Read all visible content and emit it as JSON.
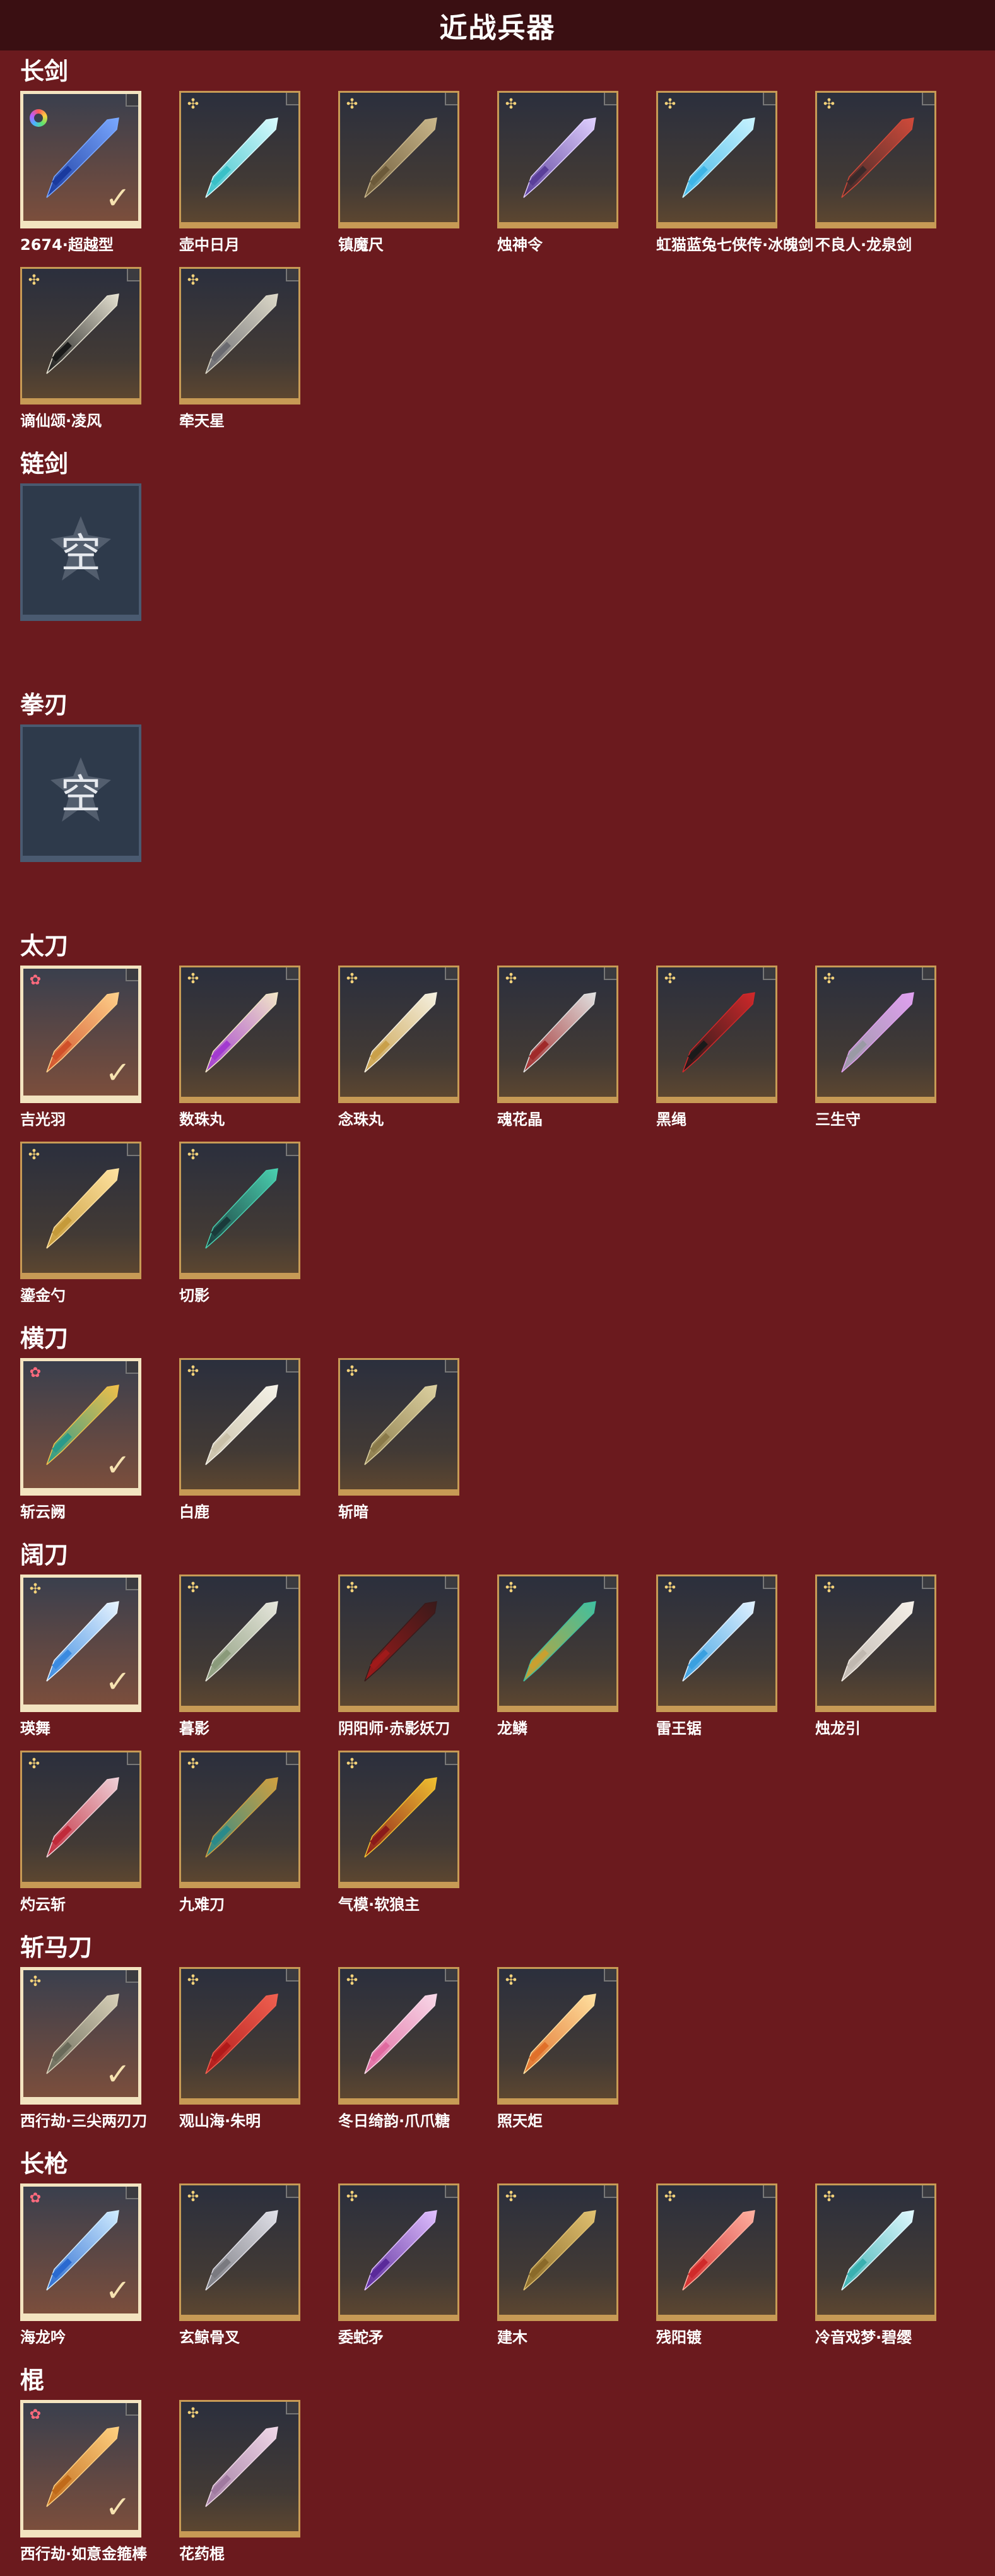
{
  "page_title": "近战兵器",
  "empty_label": "空",
  "sections": [
    {
      "title": "长剑",
      "items": [
        {
          "label": "2674·超越型",
          "badge": "ring",
          "selected": true,
          "colors": [
            "#1a3a9e",
            "#7aa8ff"
          ]
        },
        {
          "label": "壶中日月",
          "badge": "star",
          "colors": [
            "#3ac0c7",
            "#d9fbff"
          ]
        },
        {
          "label": "镇魔尺",
          "badge": "star",
          "colors": [
            "#6c5a3a",
            "#c9b68a"
          ]
        },
        {
          "label": "烛神令",
          "badge": "star",
          "colors": [
            "#5a3f9a",
            "#e0d0ff"
          ]
        },
        {
          "label": "虹猫蓝兔七侠传·冰魄剑",
          "badge": "star",
          "colors": [
            "#3fb5e6",
            "#c8f3ff"
          ]
        },
        {
          "label": "不良人·龙泉剑",
          "badge": "star",
          "colors": [
            "#3a2a2a",
            "#d04a3a"
          ]
        },
        {
          "label": "谪仙颂·凌风",
          "badge": "star",
          "colors": [
            "#1a1a1a",
            "#e6e2d2"
          ]
        },
        {
          "label": "牵天星",
          "badge": "star",
          "colors": [
            "#6a6a70",
            "#dcd8c8"
          ]
        }
      ]
    },
    {
      "title": "链剑",
      "items": []
    },
    {
      "title": "拳刃",
      "items": []
    },
    {
      "title": "太刀",
      "items": [
        {
          "label": "吉光羽",
          "badge": "pink",
          "selected": true,
          "colors": [
            "#d0502a",
            "#ffd08a"
          ]
        },
        {
          "label": "数珠丸",
          "badge": "star",
          "colors": [
            "#a23ad0",
            "#f2e6c8"
          ]
        },
        {
          "label": "念珠丸",
          "badge": "star",
          "colors": [
            "#c9a04a",
            "#f5f0e0"
          ]
        },
        {
          "label": "魂花晶",
          "badge": "star",
          "colors": [
            "#a02a2a",
            "#e0e0e0"
          ]
        },
        {
          "label": "黑绳",
          "badge": "star",
          "colors": [
            "#1a1a1a",
            "#d0282a"
          ]
        },
        {
          "label": "三生守",
          "badge": "star",
          "colors": [
            "#9a9aa5",
            "#e0a0f0"
          ]
        },
        {
          "label": "鎏金勺",
          "badge": "star",
          "colors": [
            "#c59a3a",
            "#ffe2a0"
          ]
        },
        {
          "label": "切影",
          "badge": "star",
          "colors": [
            "#1a3a3a",
            "#4ad0b0"
          ]
        }
      ]
    },
    {
      "title": "横刀",
      "items": [
        {
          "label": "斩云阙",
          "badge": "pink",
          "selected": true,
          "colors": [
            "#2a9a8a",
            "#f0c04a"
          ]
        },
        {
          "label": "白鹿",
          "badge": "star",
          "colors": [
            "#c9c0a8",
            "#f5f2e8"
          ]
        },
        {
          "label": "斩暗",
          "badge": "star",
          "colors": [
            "#8a7a4a",
            "#dcd0a0"
          ]
        }
      ]
    },
    {
      "title": "阔刀",
      "items": [
        {
          "label": "瑛舞",
          "badge": "star",
          "selected": true,
          "colors": [
            "#3a8ae0",
            "#e8f4ff"
          ]
        },
        {
          "label": "暮影",
          "badge": "star",
          "colors": [
            "#8a9a7a",
            "#e6e6dc"
          ]
        },
        {
          "label": "阴阳师·赤影妖刀",
          "badge": "star",
          "colors": [
            "#a01a1a",
            "#3a1a1a"
          ]
        },
        {
          "label": "龙鳞",
          "badge": "star",
          "colors": [
            "#c9a030",
            "#40c0a0"
          ]
        },
        {
          "label": "雷王锯",
          "badge": "star",
          "colors": [
            "#3aa0e0",
            "#e0f0ff"
          ]
        },
        {
          "label": "烛龙引",
          "badge": "star",
          "colors": [
            "#c0b8b0",
            "#f5efe8"
          ]
        },
        {
          "label": "灼云斩",
          "badge": "star",
          "colors": [
            "#c02a3a",
            "#f0d0d8"
          ]
        },
        {
          "label": "九难刀",
          "badge": "star",
          "colors": [
            "#2a8a8a",
            "#d0a040"
          ]
        },
        {
          "label": "气模·软狼主",
          "badge": "star",
          "colors": [
            "#8a1a1a",
            "#f0c030"
          ]
        }
      ]
    },
    {
      "title": "斩马刀",
      "items": [
        {
          "label": "西行劫·三尖两刃刀",
          "badge": "star",
          "selected": true,
          "colors": [
            "#6a6a5a",
            "#d8d0b8"
          ]
        },
        {
          "label": "观山海·朱明",
          "badge": "star",
          "colors": [
            "#b01a1a",
            "#f06050"
          ]
        },
        {
          "label": "冬日绮韵·爪爪糖",
          "badge": "star",
          "colors": [
            "#e06aa0",
            "#f8d8e8"
          ]
        },
        {
          "label": "照天炬",
          "badge": "star",
          "colors": [
            "#e0702a",
            "#ffe0a0"
          ]
        }
      ]
    },
    {
      "title": "长枪",
      "items": [
        {
          "label": "海龙吟",
          "badge": "pink",
          "selected": true,
          "colors": [
            "#2a6ad0",
            "#d0ecff"
          ]
        },
        {
          "label": "玄鲸骨叉",
          "badge": "star",
          "colors": [
            "#7a7a80",
            "#e0e0e8"
          ]
        },
        {
          "label": "委蛇矛",
          "badge": "star",
          "colors": [
            "#5a2a9a",
            "#e0c0ff"
          ]
        },
        {
          "label": "建木",
          "badge": "star",
          "colors": [
            "#8a6a2a",
            "#e0c070"
          ]
        },
        {
          "label": "残阳镀",
          "badge": "star",
          "colors": [
            "#d02a2a",
            "#ffb0a0"
          ]
        },
        {
          "label": "冷音戏梦·碧缨",
          "badge": "star",
          "colors": [
            "#3ab0b0",
            "#e0f8ff"
          ]
        }
      ]
    },
    {
      "title": "棍",
      "items": [
        {
          "label": "西行劫·如意金箍棒",
          "badge": "pink",
          "selected": true,
          "colors": [
            "#c06a1a",
            "#ffd080"
          ]
        },
        {
          "label": "花药棍",
          "badge": "star",
          "colors": [
            "#a07aa0",
            "#f0d8e8"
          ]
        }
      ]
    }
  ]
}
